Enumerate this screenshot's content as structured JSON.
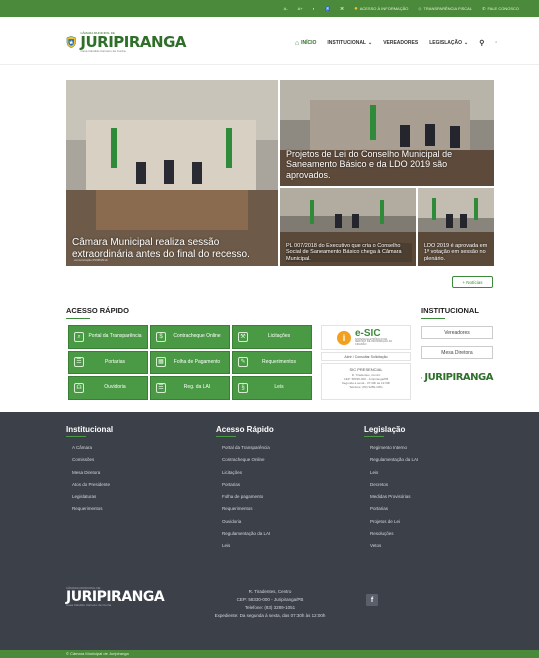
{
  "topbar": {
    "font_decrease": "A-",
    "font_increase": "A+",
    "contrast": "◐",
    "accessibility": "♿",
    "sitemap": "⌘",
    "info_access": "ACESSO À INFORMAÇÃO",
    "transparency": "TRANSPARÊNCIA FISCAL",
    "contact": "FALE CONOSCO",
    "accent": "#4a8a3a"
  },
  "logo": {
    "top_text": "CÂMARA MUNICIPAL DE",
    "name": "JURIPIRANGA",
    "subtitle": "Casa Cândido Carneiro da Cunha"
  },
  "nav": {
    "home": "INÍCIO",
    "institucional": "INSTITUCIONAL",
    "vereadores": "VEREADORES",
    "legislacao": "LEGISLAÇÃO",
    "search_icon": "search-icon"
  },
  "news": {
    "main_title": "Câmara Municipal realiza sessão extraordinária antes do final do recesso.",
    "main_meta_author": "comunicação",
    "main_meta_date": "05/08/2019",
    "top_title": "Projetos de Lei do Conselho Municipal de Saneamento Básico e da LDO 2019 são aprovados.",
    "bl_title": "PL 007/2018 do Executivo que cria o Conselho Social de Saneamento Básico chega à Câmara Municipal.",
    "br_title": "LDO 2019 é aprovada em 1ª votação em sessão no plenário.",
    "more_button": "+ Notícias"
  },
  "acesso": {
    "title": "ACESSO RÁPIDO",
    "items": [
      {
        "label": "Portal da Transparência",
        "icon": "⌕"
      },
      {
        "label": "Contracheque Online",
        "icon": "$"
      },
      {
        "label": "Licitações",
        "icon": "⚒"
      },
      {
        "label": "Portarias",
        "icon": "☰"
      },
      {
        "label": "Folha de Pagamento",
        "icon": "▦"
      },
      {
        "label": "Requerimentos",
        "icon": "✎"
      },
      {
        "label": "Ouvidoria",
        "icon": "☊"
      },
      {
        "label": "Reg. da LAI",
        "icon": "☰"
      },
      {
        "label": "Leis",
        "icon": "§"
      }
    ]
  },
  "esic": {
    "title": "e-SIC",
    "subtitle": "SISTEMA ELETRÔNICO DO SERVIÇO DE INFORMAÇÃO AO CIDADÃO",
    "link": "Abrir / Consultar Solicitação",
    "presencial_title": "SIC PRESENCIAL",
    "presencial_line1": "R. Tiradentes, Centro",
    "presencial_line2": "CEP: 58330-000 - Juripiranga/PB",
    "presencial_line3": "Segunda a sexta - 07:30h às 12:00h",
    "presencial_line4": "Telefone: (83) 3289-1051"
  },
  "institucional": {
    "title": "INSTITUCIONAL",
    "vereadores": "Vereadores",
    "mesa": "Mesa Diretora"
  },
  "footer": {
    "col1_title": "Institucional",
    "col1_links": [
      "A Câmara",
      "Comissões",
      "Mesa Diretora",
      "Atos do Presidente",
      "Legislaturas",
      "Requerimentos"
    ],
    "col2_title": "Acesso Rápido",
    "col2_links": [
      "Portal da Transparência",
      "Contracheque Online",
      "Licitações",
      "Portarias",
      "Folha de pagamento",
      "Requerimentos",
      "Ouvidoria",
      "Regulamentação da LAI",
      "Leis"
    ],
    "col3_title": "Legislação",
    "col3_links": [
      "Regimento Interno",
      "Regulamentação da LAI",
      "Leis",
      "Decretos",
      "Medidas Provisórias",
      "Portarias",
      "Projetos de Lei",
      "Resoluções",
      "Vetos"
    ],
    "address1": "R. Tiradentes, Centro",
    "address2": "CEP: 58330-000 - Juripiranga/PB",
    "phone": "Telefone: (83) 3289-1051",
    "hours": "Expediente: Da segunda à sexta, das 07:30h às 12:00h",
    "facebook": "f",
    "copyright": "© Câmara Municipal de Juripiranga"
  }
}
